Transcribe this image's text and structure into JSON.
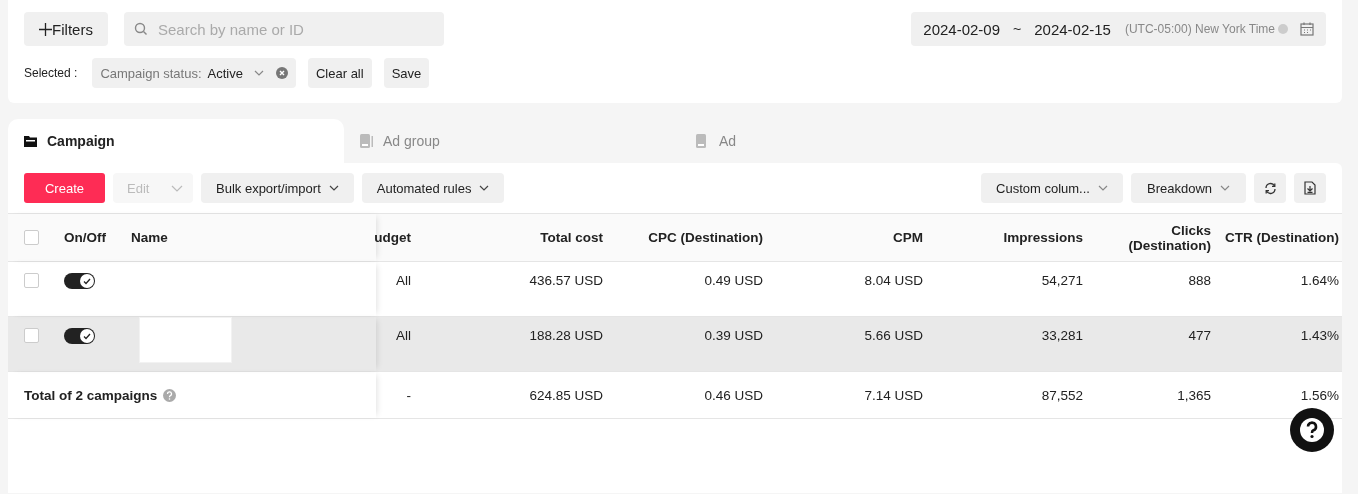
{
  "filters": {
    "button": "Filters",
    "search": {
      "placeholder": "Search by name or ID"
    },
    "date_start": "2024-02-09",
    "date_sep": "~",
    "date_end": "2024-02-15",
    "timezone": "(UTC-05:00) New York Time",
    "selected_label": "Selected :",
    "chips": [
      {
        "label": "Campaign status:",
        "value": "Active"
      }
    ],
    "clear_all": "Clear all",
    "save": "Save"
  },
  "tabs": [
    {
      "label": "Campaign",
      "selected": true
    },
    {
      "label": "Ad group",
      "selected": false
    },
    {
      "label": "Ad",
      "selected": false
    }
  ],
  "toolbar": {
    "create": "Create",
    "edit": {
      "label": "Edit",
      "disabled": true
    },
    "bulk": "Bulk export/import",
    "rules": "Automated rules",
    "custom": "Custom colum...",
    "breakdown": "Breakdown"
  },
  "table": {
    "select_all_checked": false,
    "frozen_columns": [
      "On/Off",
      "Name"
    ],
    "columns": [
      "udget",
      "Total cost",
      "CPC (Destination)",
      "CPM",
      "Impressions",
      "Clicks (Destination)",
      "CTR (Destination)"
    ],
    "rows": [
      {
        "checked": false,
        "on": true,
        "redacted": false,
        "selected": false,
        "cells": [
          "All",
          "436.57 USD",
          "0.49 USD",
          "8.04 USD",
          "54,271",
          "888",
          "1.64%"
        ]
      },
      {
        "checked": false,
        "on": true,
        "redacted": true,
        "selected": true,
        "cells": [
          "All",
          "188.28 USD",
          "0.39 USD",
          "5.66 USD",
          "33,281",
          "477",
          "1.43%"
        ]
      }
    ],
    "total": {
      "label": "Total of 2 campaigns",
      "cells": [
        "-",
        "624.85 USD",
        "0.46 USD",
        "7.14 USD",
        "87,552",
        "1,365",
        "1.56%"
      ]
    }
  }
}
